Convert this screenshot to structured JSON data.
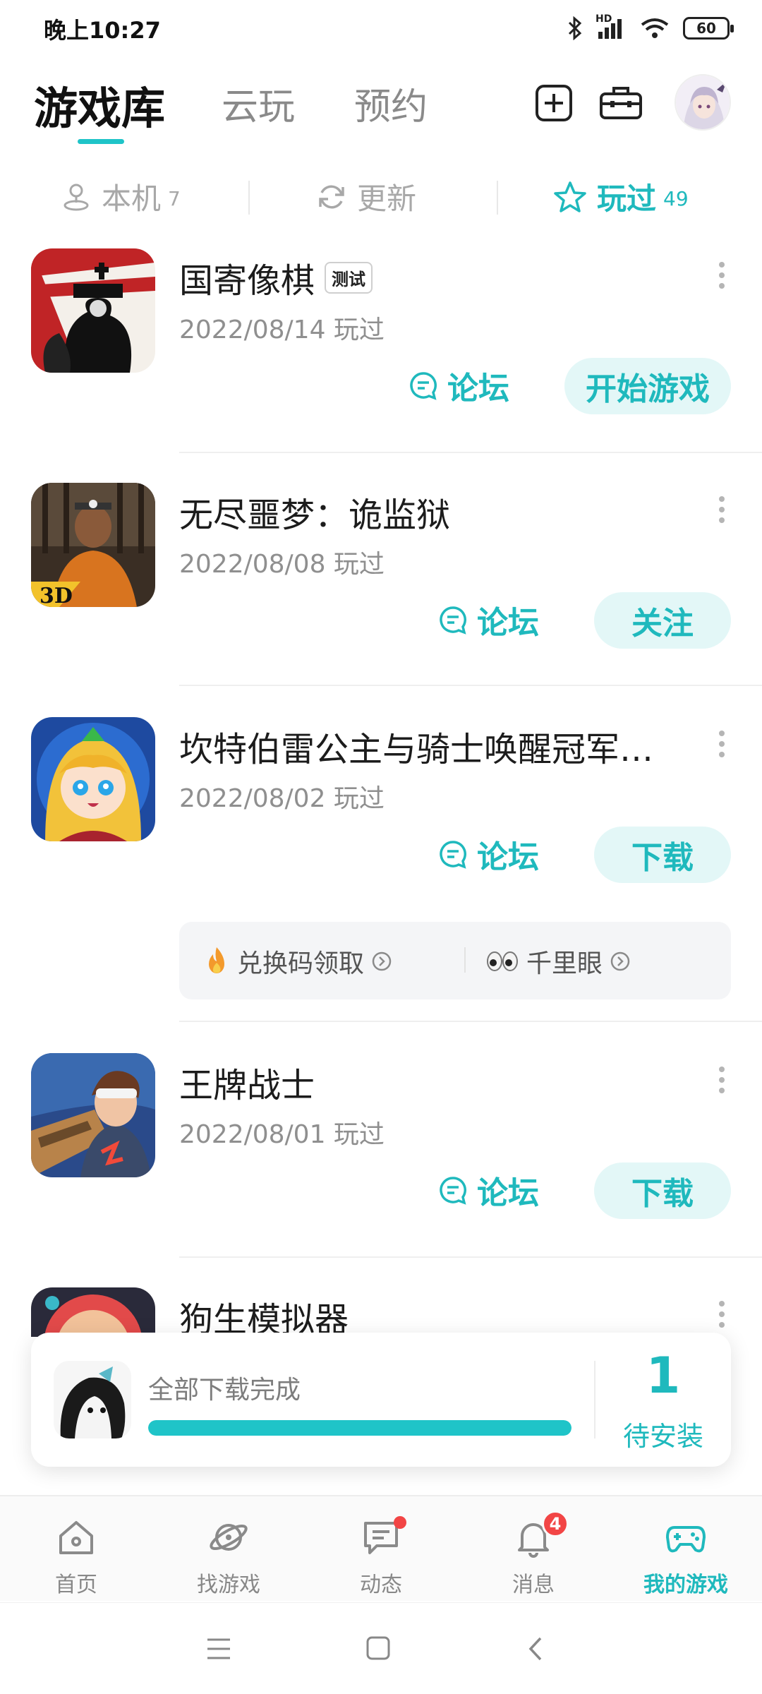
{
  "status_bar": {
    "time": "晚上10:27",
    "battery": "60",
    "network": "HD"
  },
  "top_tabs": [
    {
      "label": "游戏库",
      "active": true
    },
    {
      "label": "云玩",
      "active": false
    },
    {
      "label": "预约",
      "active": false
    }
  ],
  "filters": [
    {
      "label": "本机",
      "count": "7",
      "icon": "device-icon",
      "active": false
    },
    {
      "label": "更新",
      "count": "",
      "icon": "refresh-icon",
      "active": false
    },
    {
      "label": "玩过",
      "count": "49",
      "icon": "star-icon",
      "active": true
    }
  ],
  "games": [
    {
      "name": "国寄像棋",
      "tag": "测试",
      "date": "2022/08/14 玩过",
      "forum_label": "论坛",
      "action_label": "开始游戏"
    },
    {
      "name": "无尽噩梦：诡监狱",
      "tag": "",
      "date": "2022/08/08 玩过",
      "forum_label": "论坛",
      "action_label": "关注"
    },
    {
      "name": "坎特伯雷公主与骑士唤醒冠军…",
      "tag": "",
      "date": "2022/08/02 玩过",
      "forum_label": "论坛",
      "action_label": "下载",
      "extras": [
        {
          "label": "兑换码领取",
          "icon": "fire-icon"
        },
        {
          "label": "千里眼",
          "icon": "eyes-icon"
        }
      ]
    },
    {
      "name": "王牌战士",
      "tag": "",
      "date": "2022/08/01 玩过",
      "forum_label": "论坛",
      "action_label": "下载"
    },
    {
      "name": "狗生模拟器",
      "tag": "",
      "date": "",
      "forum_label": "",
      "action_label": ""
    }
  ],
  "download_toast": {
    "text": "全部下载完成",
    "progress": 1.0,
    "count": "1",
    "pending_label": "待安装"
  },
  "bottom_nav": [
    {
      "label": "首页",
      "icon": "home-icon",
      "active": false
    },
    {
      "label": "找游戏",
      "icon": "planet-icon",
      "active": false
    },
    {
      "label": "动态",
      "icon": "chat-icon",
      "active": false,
      "dot": true
    },
    {
      "label": "消息",
      "icon": "bell-icon",
      "active": false,
      "badge": "4"
    },
    {
      "label": "我的游戏",
      "icon": "gamepad-icon",
      "active": true
    }
  ],
  "colors": {
    "accent": "#1fb9bd",
    "accent_light": "#e3f7f7",
    "badge": "#f24545"
  }
}
